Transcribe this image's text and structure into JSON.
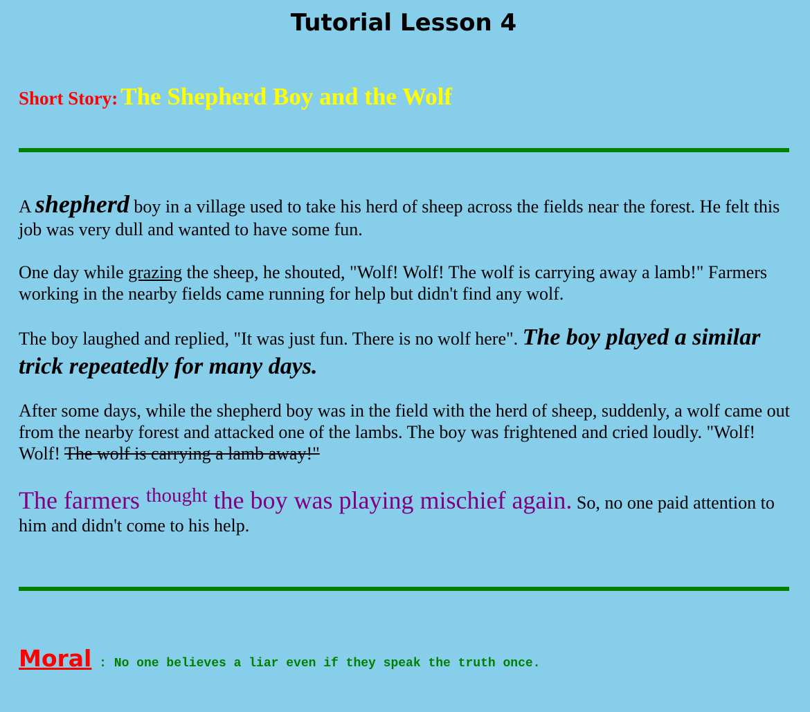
{
  "page": {
    "title": "Tutorial Lesson 4",
    "background_color": "#87ceeb"
  },
  "story": {
    "label": "Short Story:",
    "title": "The Shepherd Boy and the Wolf",
    "label_color": "#ff0000",
    "title_color": "#ffff00"
  },
  "divider_color": "#008000",
  "paragraphs": {
    "p1": {
      "before": "A ",
      "emphasis": "shepherd",
      "after": " boy in a village used to take his herd of sheep across the fields near the forest. He felt this job was very dull and wanted to have some fun."
    },
    "p2": {
      "before": "One day while ",
      "underlined": "grazing",
      "after": " the sheep, he shouted, \"Wolf! Wolf! The wolf is carrying away a lamb!\" Farmers working in the nearby fields came running for help but didn't find any wolf."
    },
    "p3": {
      "plain": "The boy laughed and replied, \"It was just fun. There is no wolf here\". ",
      "emphasis": "The boy played a similar trick repeatedly for many days."
    },
    "p4": {
      "plain": "After some days, while the shepherd boy was in the field with the herd of sheep, suddenly, a wolf came out from the nearby forest and attacked one of the lambs. The boy was frightened and cried loudly. \"Wolf! Wolf! ",
      "struck": "The wolf is carrying a lamb away!\""
    },
    "p5": {
      "purple_before": "The farmers ",
      "superscript": "thought",
      "purple_after": " the boy was playing mischief again.",
      "plain": " So, no one paid attention to him and didn't come to his help.",
      "purple_color": "#800080"
    }
  },
  "moral": {
    "label": "Moral",
    "separator": " : ",
    "text": "No one believes a liar even if they speak the truth once.",
    "label_color": "#ff0000",
    "text_color": "#008000"
  }
}
